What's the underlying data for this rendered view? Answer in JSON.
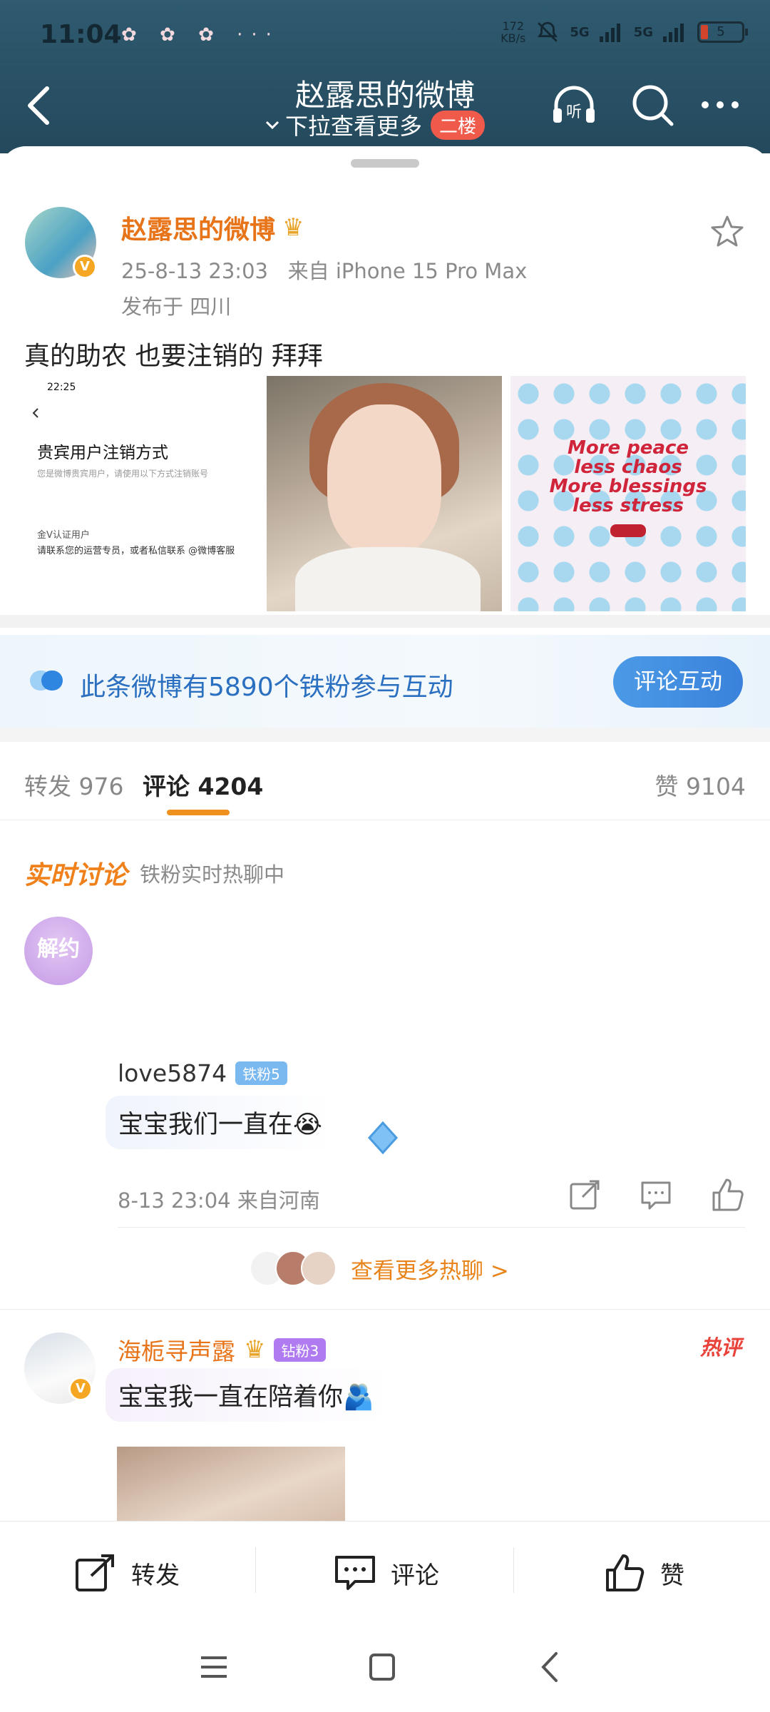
{
  "status": {
    "time": "11:04",
    "notif_icons": "✿ ✿ ✿ ···",
    "net_speed_line1": "172",
    "net_speed_line2": "KB/s",
    "signal1": "5G",
    "signal2": "5G",
    "battery": "5"
  },
  "nav": {
    "title": "赵露思的微博",
    "subtitle": "下拉查看更多",
    "floor_badge": "二楼",
    "listen_label": "听"
  },
  "post": {
    "author": "赵露思的微博",
    "date": "25-8-13 23:03",
    "source": "来自 iPhone 15 Pro Max",
    "location": "发布于 四川",
    "text": "真的助农 也要注销的 拜拜",
    "image1": {
      "time": "22:25",
      "title": "贵宾用户注销方式",
      "desc": "您是微博贵宾用户，请使用以下方式注销账号",
      "vrow": "金V认证用户",
      "contact": "请联系您的运营专员，或者私信联系 @微博客服"
    },
    "image3_text": [
      "More peace",
      "less chaos",
      "More blessings",
      "less stress"
    ]
  },
  "fans": {
    "text": "此条微博有5890个铁粉参与互动",
    "button": "评论互动"
  },
  "tabs": {
    "repost": "转发 976",
    "comment": "评论 4204",
    "like": "赞 9104"
  },
  "live": {
    "title": "实时讨论",
    "subtitle": "铁粉实时热聊中"
  },
  "comment1": {
    "avatar_text": "解约",
    "name": "love5874",
    "badge": "铁粉5",
    "text": "宝宝我们一直在😭",
    "meta": "8-13 23:04  来自河南"
  },
  "more_chat": "查看更多热聊 >",
  "comment2": {
    "name": "海栀寻声露",
    "badge": "钻粉3",
    "hot": "热评",
    "text": "宝宝我一直在陪着你🫂"
  },
  "bottom": {
    "repost": "转发",
    "comment": "评论",
    "like": "赞"
  },
  "colors": {
    "accent_orange": "#e8741a",
    "link_blue": "#2a6fc0",
    "header_bg": "#2f5a6f"
  }
}
